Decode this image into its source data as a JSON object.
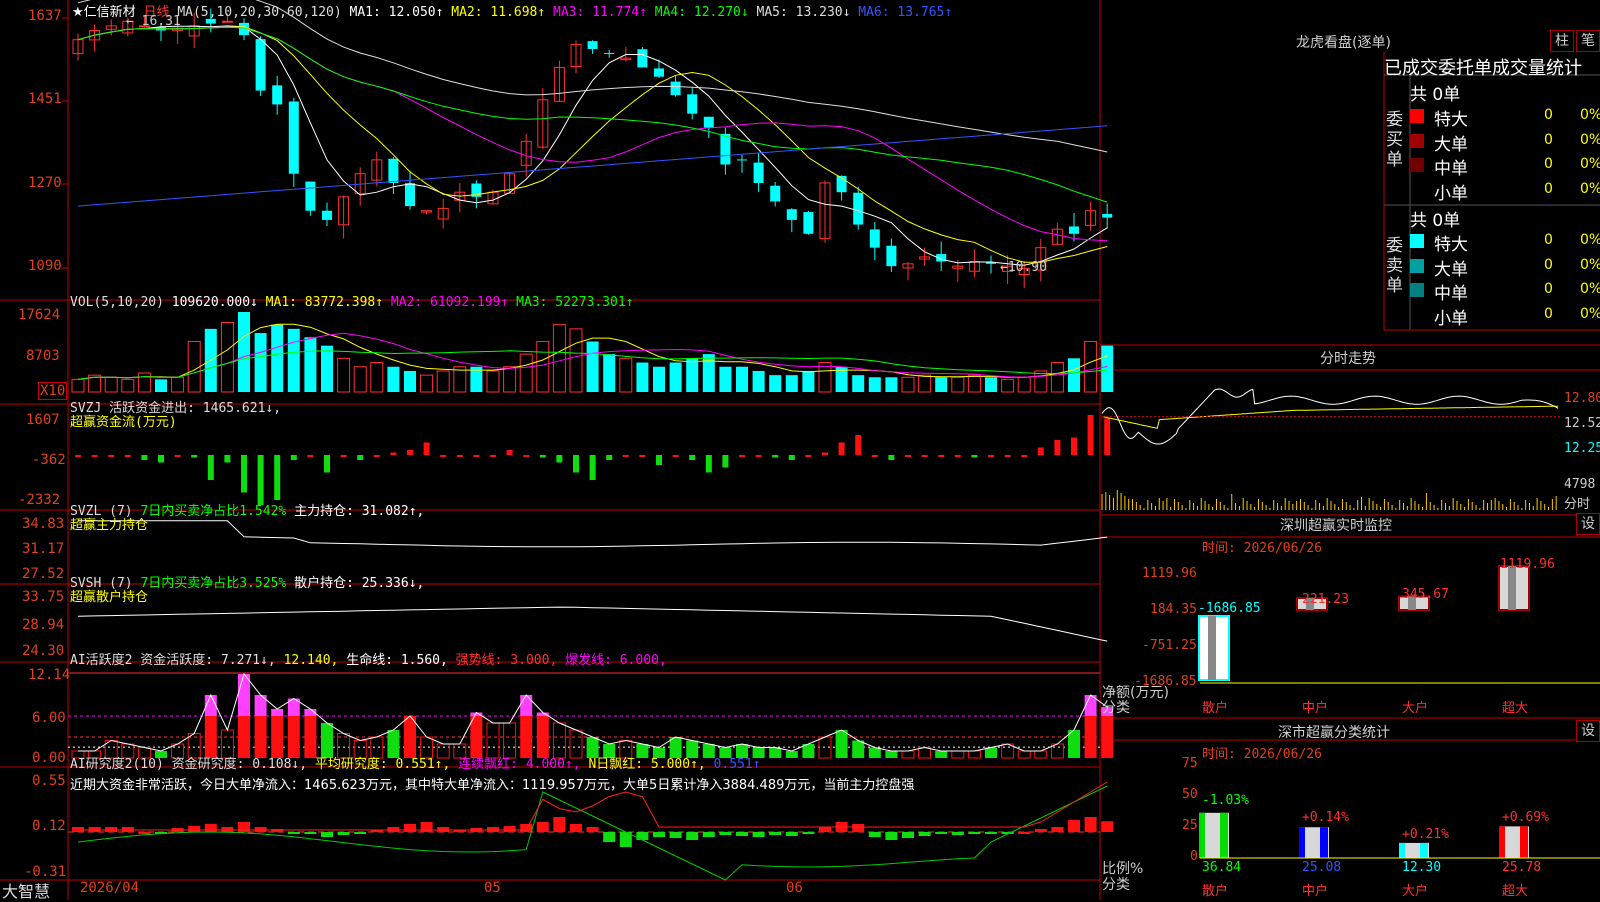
{
  "stock": {
    "name": "★仁信新材",
    "period": "日线",
    "high_mark": "16.31",
    "low_mark": "10.90",
    "top_label": "1637"
  },
  "ma_line": [
    {
      "text": "MA(5,10,20,30,60,120)",
      "color": "#dddddd"
    },
    {
      "text": "MA1: 12.050↑",
      "color": "#ffffff"
    },
    {
      "text": "MA2: 11.698↑",
      "color": "#ffff00"
    },
    {
      "text": "MA3: 11.774↑",
      "color": "#ff00ff"
    },
    {
      "text": "MA4: 12.270↓",
      "color": "#00ff00"
    },
    {
      "text": "MA5: 13.230↓",
      "color": "#dddddd"
    },
    {
      "text": "MA6: 13.765↑",
      "color": "#3355ff"
    }
  ],
  "price_axis": [
    "1637",
    "1451",
    "1270",
    "1090"
  ],
  "vol_axis": [
    "17624",
    "8703",
    "X10"
  ],
  "vol_line": [
    {
      "text": "VOL(5,10,20)",
      "color": "#dddddd"
    },
    {
      "text": "109620.000↓",
      "color": "#ffffff"
    },
    {
      "text": "MA1: 83772.398↑",
      "color": "#ffff00"
    },
    {
      "text": "MA2: 61092.199↑",
      "color": "#ff00ff"
    },
    {
      "text": "MA3: 52273.301↑",
      "color": "#00ff00"
    }
  ],
  "svzj": {
    "axis": [
      "1607",
      "-362",
      "-2332"
    ],
    "line1": "SVZJ  活跃资金进出: 1465.621↓,",
    "line2": "超赢资金流(万元)"
  },
  "svzl": {
    "axis": [
      "34.83",
      "31.17",
      "27.52"
    ],
    "line1_a": "SVZL (7)",
    "line1_b": "7日内买卖净占比1.542%",
    "line1_c": "主力持仓: 31.082↑,",
    "line2": "超赢主力持仓"
  },
  "svsh": {
    "axis": [
      "33.75",
      "28.94",
      "24.30"
    ],
    "line1_a": "SVSH (7)",
    "line1_b": "7日内买卖净占比3.525%",
    "line1_c": "散户持仓: 25.336↓,",
    "line2": "超赢散户持仓"
  },
  "ai_active": {
    "axis": [
      "12.14",
      "6.00",
      "0.00"
    ],
    "items": [
      {
        "text": "AI活跃度2 资金活跃度: 7.271↓,",
        "color": "#dddddd"
      },
      {
        "text": "12.140,",
        "color": "#ffff00"
      },
      {
        "text": "生命线: 1.560,",
        "color": "#ffffff"
      },
      {
        "text": "强势线: 3.000,",
        "color": "#ff3030"
      },
      {
        "text": "爆发线: 6.000,",
        "color": "#ff00ff"
      }
    ]
  },
  "ai_research": {
    "axis": [
      "0.55",
      "0.12",
      "-0.31"
    ],
    "items": [
      {
        "text": "AI研究度2(10) 资金研究度: 0.108↓,",
        "color": "#dddddd"
      },
      {
        "text": "平均研究度: 0.551↑,",
        "color": "#ffff00"
      },
      {
        "text": "连续飘红: 4.000↑,",
        "color": "#ff00ff"
      },
      {
        "text": "N日飘红: 5.000↑,",
        "color": "#ffff00"
      },
      {
        "text": "0.551↑",
        "color": "#3355ff"
      }
    ],
    "summary": "近期大资金非常活跃，今日大单净流入：1465.623万元，其中特大单净流入：1119.957万元，大单5日累计净入3884.489万元，当前主力控盘强"
  },
  "bottom": {
    "brand": "大智慧",
    "date_start": "2026/04",
    "month_05": "05",
    "month_06": "06"
  },
  "dragon": {
    "title": "龙虎看盘(逐单)",
    "btn1": "柱",
    "btn2": "笔",
    "subtitle": "已成交委托单成交量统计",
    "buy_label": "委买单",
    "sell_label": "委卖单",
    "buy_total": "共 0单",
    "sell_total": "共 0单",
    "buy_rows": [
      {
        "name": "特大",
        "val": "0",
        "pct": "0%",
        "color": "#ff0000"
      },
      {
        "name": "大单",
        "val": "0",
        "pct": "0%",
        "color": "#a00000"
      },
      {
        "name": "中单",
        "val": "0",
        "pct": "0%",
        "color": "#700000"
      },
      {
        "name": "小单",
        "val": "0",
        "pct": "0%",
        "color": ""
      }
    ],
    "sell_rows": [
      {
        "name": "特大",
        "val": "0",
        "pct": "0%",
        "color": "#00ffff"
      },
      {
        "name": "大单",
        "val": "0",
        "pct": "0%",
        "color": "#00a0a0"
      },
      {
        "name": "中单",
        "val": "0",
        "pct": "0%",
        "color": "#008080"
      },
      {
        "name": "小单",
        "val": "0",
        "pct": "0%",
        "color": ""
      }
    ]
  },
  "intraday": {
    "title": "分时走势",
    "axis": [
      "12.80",
      "12.52",
      "12.25"
    ],
    "vol_top": "4798",
    "vol_bottom": "分时"
  },
  "sz_monitor": {
    "title": "深圳超赢实时监控",
    "set": "设",
    "time": "时间: 2026/06/26",
    "axis": [
      "1119.96",
      "184.35",
      "-751.25",
      "-1686.85"
    ],
    "ylabel1": "净额(万元)",
    "ylabel2": "分类",
    "bars": [
      {
        "name": "散户",
        "value": "-1686.85",
        "v": -1686.85
      },
      {
        "name": "中户",
        "value": "221.23",
        "v": 221.23
      },
      {
        "name": "大户",
        "value": "345.67",
        "v": 345.67
      },
      {
        "name": "超大",
        "value": "1119.96",
        "v": 1119.96
      }
    ]
  },
  "sz_class": {
    "title": "深市超赢分类统计",
    "set": "设",
    "time": "时间: 2026/06/26",
    "axis": [
      "75",
      "50",
      "25",
      "0"
    ],
    "ylabel1": "比例%",
    "ylabel2": "分类",
    "bars": [
      {
        "name": "散户",
        "change": "-1.03%",
        "value": "36.84",
        "v": 36.84
      },
      {
        "name": "中户",
        "change": "+0.14%",
        "value": "25.08",
        "v": 25.08
      },
      {
        "name": "大户",
        "change": "+0.21%",
        "value": "12.30",
        "v": 12.3
      },
      {
        "name": "超大",
        "change": "+0.69%",
        "value": "25.78",
        "v": 25.78
      }
    ]
  }
}
